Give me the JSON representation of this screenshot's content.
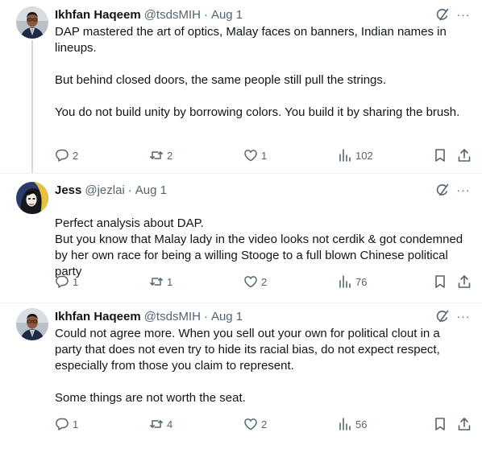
{
  "tweets": [
    {
      "author": "Ikhfan Haqeem",
      "handle": "@tsdsMIH",
      "dot": "·",
      "time": "Aug 1",
      "paragraphs": [
        "DAP mastered the art of optics, Malay faces on banners, Indian names in lineups.",
        "But behind closed doors, the same people still pull the strings.",
        "You do not build unity by borrowing colors. You build it by sharing the brush."
      ],
      "replies": "2",
      "reposts": "2",
      "likes": "1",
      "views": "102"
    },
    {
      "author": "Jess",
      "handle": "@jezlai",
      "dot": "·",
      "time": "Aug 1",
      "paragraphs": [
        "Perfect analysis about DAP.\nBut you know that Malay lady in the video looks not cerdik & got condemned by her own race for being a willing Stooge to a full blown Chinese political party"
      ],
      "replies": "1",
      "reposts": "1",
      "likes": "2",
      "views": "76"
    },
    {
      "author": "Ikhfan Haqeem",
      "handle": "@tsdsMIH",
      "dot": "·",
      "time": "Aug 1",
      "paragraphs": [
        "Could not agree more. When you sell out your own for political clout in a party that does not even try to hide its racial bias, do not expect respect, especially from those you claim to represent.",
        "Some things are not worth the seat."
      ],
      "replies": "1",
      "reposts": "4",
      "likes": "2",
      "views": "56"
    }
  ],
  "icons": {
    "more": "···",
    "grok": "grok-icon",
    "reply": "reply-icon",
    "repost": "repost-icon",
    "like": "like-icon",
    "views": "views-icon",
    "bookmark": "bookmark-icon",
    "share": "share-icon"
  },
  "colors": {
    "text": "#0f1419",
    "secondary": "#536471",
    "thread_line": "#cfd9de",
    "divider": "#eff3f4"
  }
}
